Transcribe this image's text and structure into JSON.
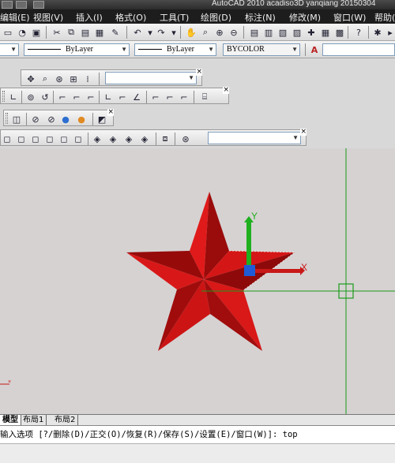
{
  "window": {
    "title": "AutoCAD 2010    acadiso3D    yanqiang  20150304"
  },
  "menubar": {
    "items": [
      "编辑(E)",
      "视图(V)",
      "插入(I)",
      "格式(O)",
      "工具(T)",
      "绘图(D)",
      "标注(N)",
      "修改(M)",
      "窗口(W)",
      "帮助(H)"
    ]
  },
  "properties": {
    "linetype_value": "ByLayer",
    "lineweight_value": "ByLayer",
    "plotstyle_value": "BYCOLOR"
  },
  "view_toolbar": {
    "combo_value": ""
  },
  "visual_toolbar": {
    "combo_value": ""
  },
  "drawing": {
    "ucs_y_label": "Y",
    "ucs_x_label": "X",
    "colors": {
      "star_light": "#cc1414",
      "star_dark": "#8e0a0a",
      "crosshair": "#1b9b1b",
      "ucs_y": "#1fb01f",
      "ucs_x": "#c81818",
      "ucs_origin": "#1f5bd6"
    }
  },
  "layout_tabs": [
    "模型",
    "布局1",
    "布局2"
  ],
  "command_line": {
    "prompt": "输入选项 [?/删除(D)/正交(O)/恢复(R)/保存(S)/设置(E)/窗口(W)]: top"
  },
  "icons": [
    "new-icon",
    "open-icon",
    "save-icon",
    "print-icon",
    "cut-icon",
    "copy-icon",
    "paste-icon",
    "undo-icon",
    "redo-icon",
    "pan-icon",
    "zoom-icon",
    "help-icon"
  ]
}
